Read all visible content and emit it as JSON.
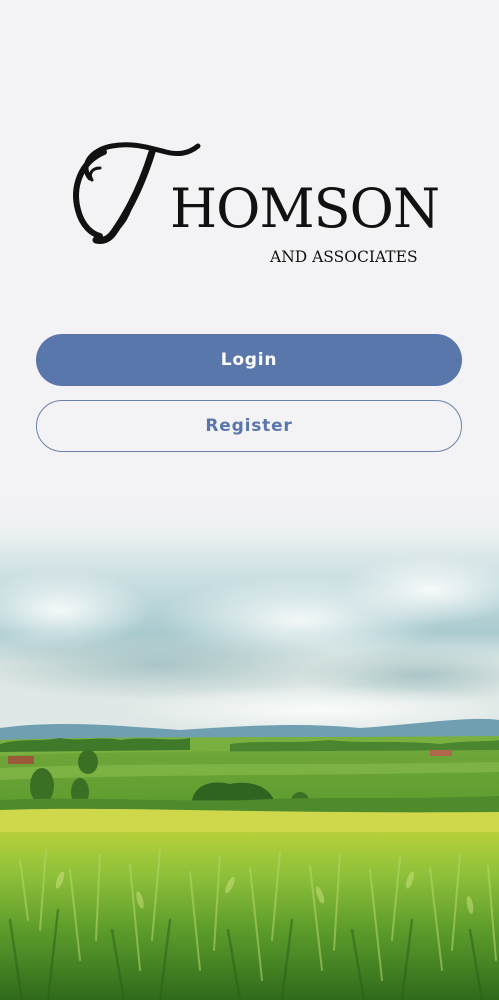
{
  "brand": {
    "initial": "T",
    "name_rest": "HOMSON",
    "subtitle": "AND ASSOCIATES"
  },
  "buttons": {
    "login_label": "Login",
    "register_label": "Register"
  },
  "colors": {
    "background": "#f3f2f4",
    "primary": "#5a77ac",
    "button_text": "#ffffff",
    "logo_text": "#111111"
  },
  "background_image": {
    "icon": "landscape-wheat-field"
  }
}
